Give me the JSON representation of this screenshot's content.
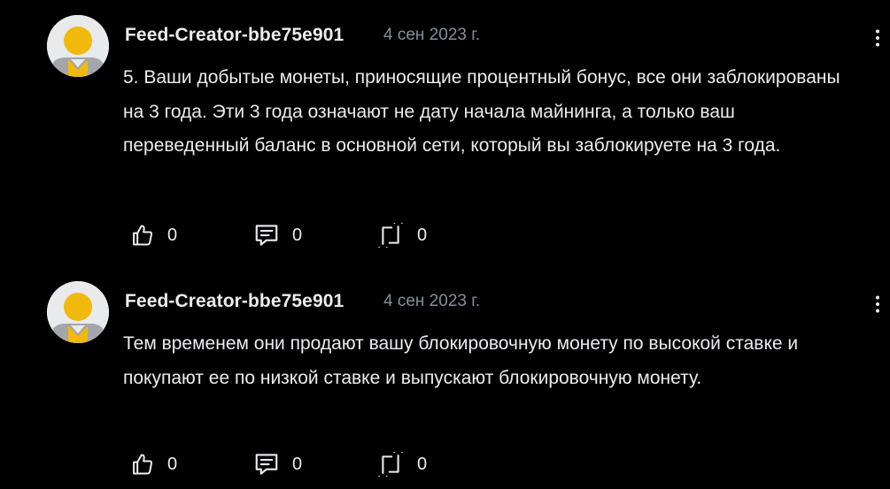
{
  "colors": {
    "background": "#000000",
    "text_primary": "#eaecef",
    "text_secondary": "#848e9c",
    "avatar_bg": "#e9eaec",
    "avatar_accent": "#f0b90b"
  },
  "posts": [
    {
      "author": "Feed-Creator-bbe75e901",
      "date": "4 сен 2023 г.",
      "text": "5. Ваши добытые монеты, приносящие процентный бонус, все они заблокированы на 3 года. Эти 3 года означают не дату начала майнинга, а только ваш переведенный баланс в основной сети, который вы заблокируете на 3 года.",
      "likes": "0",
      "comments": "0",
      "reposts": "0",
      "icons": {
        "avatar": "avatar-icon",
        "more": "more-vertical-icon",
        "like": "thumbs-up-icon",
        "comment": "comment-icon",
        "repost": "repost-icon"
      }
    },
    {
      "author": "Feed-Creator-bbe75e901",
      "date": "4 сен 2023 г.",
      "text": "Тем временем они продают вашу блокировочную монету по высокой ставке и покупают ее по низкой ставке и выпускают блокировочную монету.",
      "likes": "0",
      "comments": "0",
      "reposts": "0",
      "icons": {
        "avatar": "avatar-icon",
        "more": "more-vertical-icon",
        "like": "thumbs-up-icon",
        "comment": "comment-icon",
        "repost": "repost-icon"
      }
    }
  ]
}
